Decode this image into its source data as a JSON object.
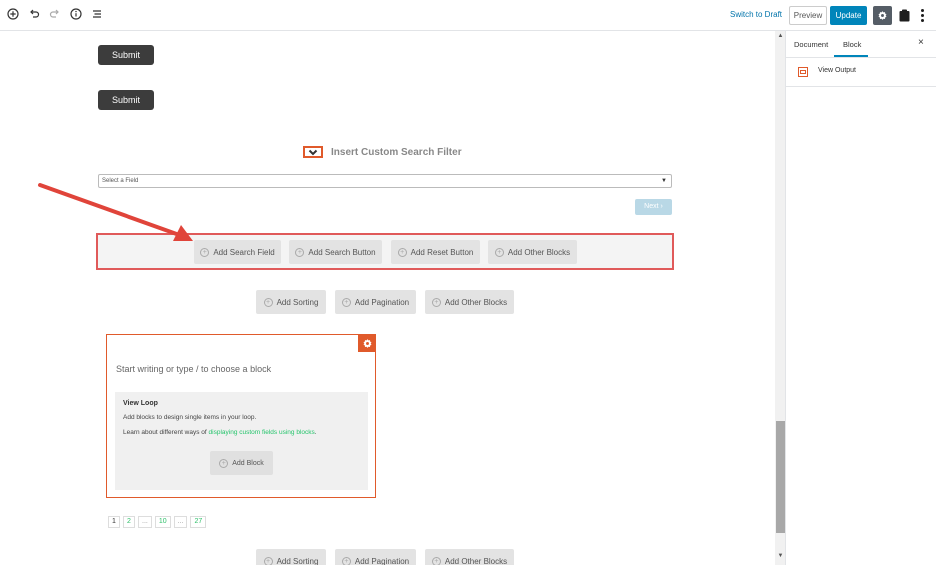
{
  "toolbar": {
    "switch_to_draft": "Switch to Draft",
    "preview": "Preview",
    "update": "Update",
    "accent_color": "#0085ba"
  },
  "editor": {
    "submit_buttons": [
      "Submit",
      "Submit"
    ],
    "filter_title": "Insert Custom Search Filter",
    "select_field": {
      "value": "Select a Field",
      "arrow": "▼"
    },
    "next_button": "Next",
    "search_buttons": [
      "Add Search Field",
      "Add Search Button",
      "Add Reset Button",
      "Add Other Blocks"
    ],
    "sort_buttons_top": [
      "Add Sorting",
      "Add Pagination",
      "Add Other Blocks"
    ],
    "loop": {
      "placeholder": "Start writing or type / to choose a block",
      "title": "View Loop",
      "description": "Add blocks to design single items in your loop.",
      "learn_prefix": "Learn about different ways of ",
      "learn_link": "displaying custom fields using blocks",
      "learn_suffix": ".",
      "add_block": "Add Block"
    },
    "pagination": [
      "1",
      "2",
      "...",
      "10",
      "...",
      "27"
    ],
    "sort_buttons_bottom": [
      "Add Sorting",
      "Add Pagination",
      "Add Other Blocks"
    ],
    "highlight_color": "#e05a2b",
    "arrow_color": "#e0443a"
  },
  "sidebar": {
    "tabs": [
      "Document",
      "Block"
    ],
    "active_tab": "Block",
    "close": "×",
    "block_name": "View Output"
  }
}
